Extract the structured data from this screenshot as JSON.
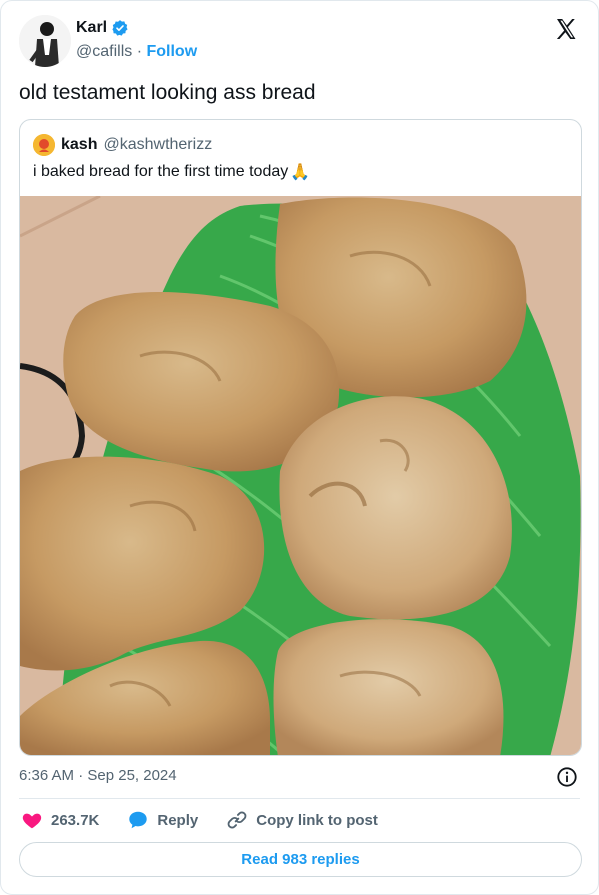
{
  "author": {
    "name": "Karl",
    "handle": "@cafills",
    "separator": "·",
    "follow_label": "Follow"
  },
  "tweet": {
    "text": "old testament looking ass bread",
    "timestamp": "6:36 AM · Sep 25, 2024"
  },
  "quoted": {
    "name": "kash",
    "handle": "@kashwtherizz",
    "text": "i baked bread for the first time today",
    "emoji": "🙏"
  },
  "actions": {
    "likes": "263.7K",
    "reply_label": "Reply",
    "copy_label": "Copy link to post"
  },
  "read_replies_label": "Read 983 replies",
  "colors": {
    "accent": "#1d9bf0",
    "like": "#f91880",
    "muted": "#536471"
  },
  "icons": [
    "verified-badge-icon",
    "x-logo-icon",
    "info-icon",
    "heart-icon",
    "reply-bubble-icon",
    "link-icon"
  ]
}
